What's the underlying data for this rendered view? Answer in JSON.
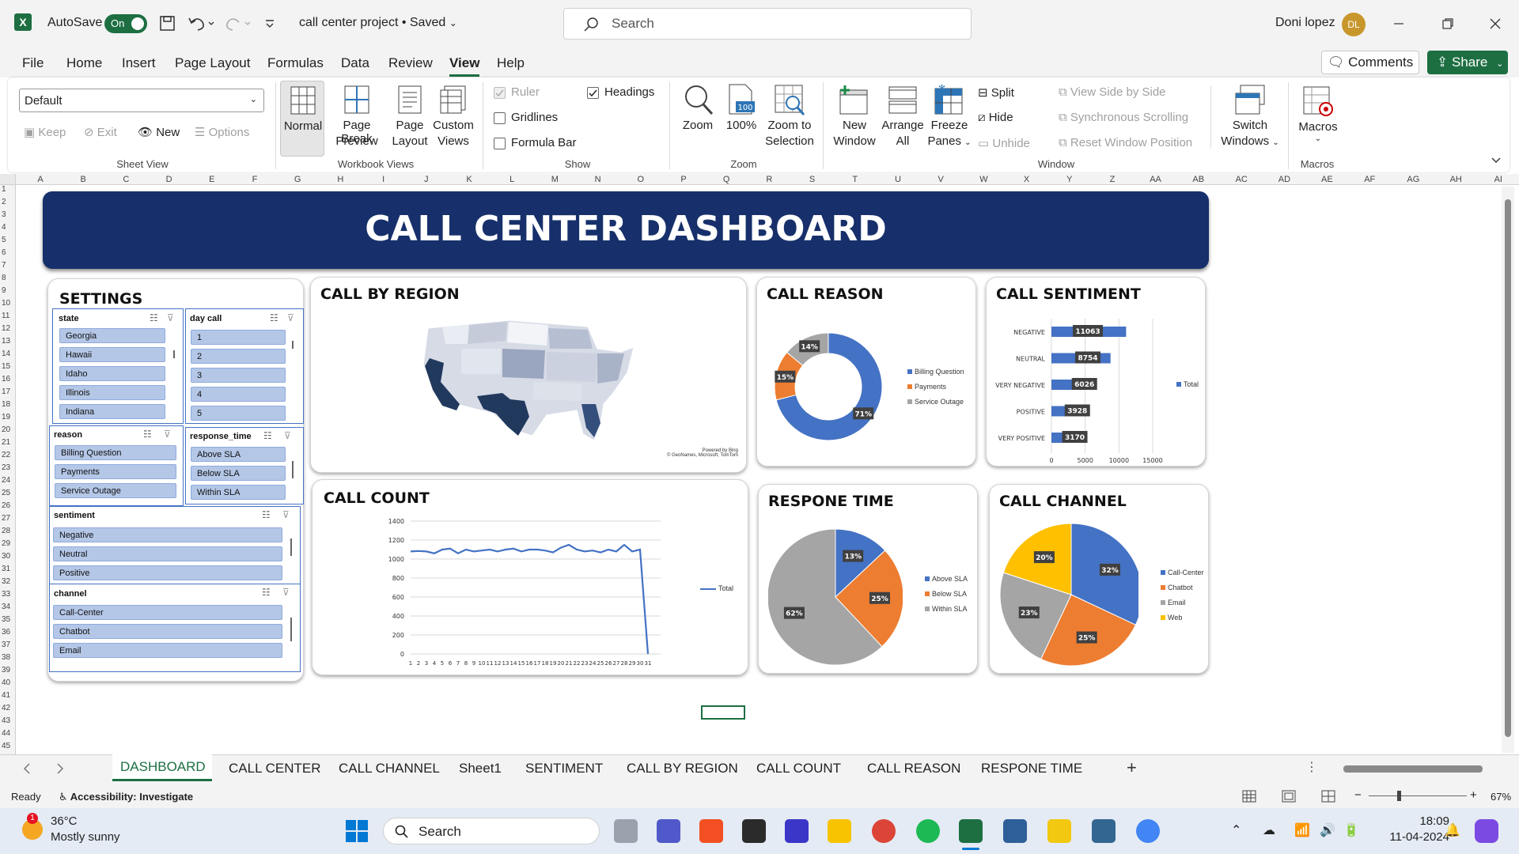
{
  "titlebar": {
    "app_icon": "excel-icon",
    "autosave_label": "AutoSave",
    "autosave_state": "On",
    "doc_title": "call center project • Saved",
    "search_placeholder": "Search",
    "user_name": "Doni lopez",
    "user_initials": "DL"
  },
  "menu": {
    "items": [
      "File",
      "Home",
      "Insert",
      "Page Layout",
      "Formulas",
      "Data",
      "Review",
      "View",
      "Help"
    ],
    "active": "View",
    "comments": "Comments",
    "share": "Share"
  },
  "ribbon": {
    "sheet_view": {
      "dropdown": "Default",
      "keep": "Keep",
      "exit": "Exit",
      "new": "New",
      "options": "Options",
      "group": "Sheet View"
    },
    "workbook_views": {
      "normal": "Normal",
      "page_break_1": "Page Break",
      "page_break_2": "Preview",
      "page_layout_1": "Page",
      "page_layout_2": "Layout",
      "custom_1": "Custom",
      "custom_2": "Views",
      "group": "Workbook Views"
    },
    "show": {
      "ruler": "Ruler",
      "headings": "Headings",
      "gridlines": "Gridlines",
      "formula_bar": "Formula Bar",
      "group": "Show"
    },
    "zoom": {
      "zoom": "Zoom",
      "hundred": "100%",
      "zoom_sel_1": "Zoom to",
      "zoom_sel_2": "Selection",
      "group": "Zoom"
    },
    "window": {
      "new_window_1": "New",
      "new_window_2": "Window",
      "arrange_1": "Arrange",
      "arrange_2": "All",
      "freeze_1": "Freeze",
      "freeze_2": "Panes",
      "split": "Split",
      "hide": "Hide",
      "unhide": "Unhide",
      "side_by_side": "View Side by Side",
      "sync_scroll": "Synchronous Scrolling",
      "reset_pos": "Reset Window Position",
      "switch_1": "Switch",
      "switch_2": "Windows",
      "group": "Window"
    },
    "macros": {
      "label": "Macros",
      "group": "Macros"
    }
  },
  "columns": [
    "A",
    "B",
    "C",
    "D",
    "E",
    "F",
    "G",
    "H",
    "I",
    "J",
    "K",
    "L",
    "M",
    "N",
    "O",
    "P",
    "Q",
    "R",
    "S",
    "T",
    "U",
    "V",
    "W",
    "X",
    "Y",
    "Z",
    "AA",
    "AB",
    "AC",
    "AD",
    "AE",
    "AF",
    "AG",
    "AH",
    "AI"
  ],
  "rows": [
    "1",
    "2",
    "3",
    "4",
    "5",
    "6",
    "7",
    "8",
    "9",
    "10",
    "11",
    "12",
    "13",
    "14",
    "15",
    "16",
    "17",
    "18",
    "19",
    "20",
    "21",
    "22",
    "23",
    "24",
    "25",
    "26",
    "27",
    "28",
    "29",
    "30",
    "31",
    "32",
    "33",
    "34",
    "35",
    "36",
    "37",
    "38",
    "39",
    "40",
    "41",
    "42",
    "43",
    "44",
    "45"
  ],
  "dashboard": {
    "title": "CALL CENTER DASHBOARD",
    "settings": {
      "title": "SETTINGS",
      "state": {
        "header": "state",
        "items": [
          "Georgia",
          "Hawaii",
          "Idaho",
          "Illinois",
          "Indiana"
        ]
      },
      "day_call": {
        "header": "day call",
        "items": [
          "1",
          "2",
          "3",
          "4",
          "5"
        ]
      },
      "reason": {
        "header": "reason",
        "items": [
          "Billing Question",
          "Payments",
          "Service Outage"
        ]
      },
      "response_time": {
        "header": "response_time",
        "items": [
          "Above SLA",
          "Below SLA",
          "Within SLA"
        ]
      },
      "sentiment": {
        "header": "sentiment",
        "items": [
          "Negative",
          "Neutral",
          "Positive"
        ]
      },
      "channel": {
        "header": "channel",
        "items": [
          "Call-Center",
          "Chatbot",
          "Email"
        ]
      }
    },
    "region": {
      "title": "CALL BY REGION",
      "credit_1": "Powered by Bing",
      "credit_2": "© GeoNames, Microsoft, TomTom"
    },
    "reason_title": "CALL REASON",
    "sentiment_title": "CALL SENTIMENT",
    "count_title": "CALL COUNT",
    "response_title": "RESPONE TIME",
    "channel_title": "CALL CHANNEL"
  },
  "chart_data": [
    {
      "type": "pie",
      "title": "CALL REASON",
      "categories": [
        "Billing Question",
        "Payments",
        "Service Outage"
      ],
      "values": [
        71,
        15,
        14
      ],
      "labels": [
        "71%",
        "15%",
        "14%"
      ],
      "colors": [
        "#4472c4",
        "#ed7d31",
        "#a5a5a5"
      ],
      "donut": true
    },
    {
      "type": "bar",
      "title": "CALL SENTIMENT",
      "orientation": "horizontal",
      "categories": [
        "NEGATIVE",
        "NEUTRAL",
        "VERY NEGATIVE",
        "POSITIVE",
        "VERY POSITIVE"
      ],
      "values": [
        11063,
        8754,
        6026,
        3928,
        3170
      ],
      "series": [
        {
          "name": "Total"
        }
      ],
      "xticks": [
        "0",
        "5000",
        "10000",
        "15000"
      ],
      "xlim": [
        0,
        15000
      ],
      "color": "#4472c4"
    },
    {
      "type": "line",
      "title": "CALL COUNT",
      "x": [
        "1",
        "2",
        "3",
        "4",
        "5",
        "6",
        "7",
        "8",
        "9",
        "10",
        "11",
        "12",
        "13",
        "14",
        "15",
        "16",
        "17",
        "18",
        "19",
        "20",
        "21",
        "22",
        "23",
        "24",
        "25",
        "26",
        "27",
        "28",
        "29",
        "30",
        "31"
      ],
      "values": [
        1080,
        1085,
        1080,
        1060,
        1100,
        1110,
        1060,
        1100,
        1080,
        1090,
        1100,
        1080,
        1100,
        1110,
        1080,
        1100,
        1100,
        1090,
        1070,
        1120,
        1150,
        1100,
        1080,
        1090,
        1070,
        1100,
        1080,
        1150,
        1080,
        1100,
        0
      ],
      "series": [
        {
          "name": "Total"
        }
      ],
      "yticks": [
        "0",
        "200",
        "400",
        "600",
        "800",
        "1000",
        "1200",
        "1400"
      ],
      "ylim": [
        0,
        1400
      ],
      "color": "#4472c4"
    },
    {
      "type": "pie",
      "title": "RESPONE TIME",
      "categories": [
        "Above SLA",
        "Below SLA",
        "Within SLA"
      ],
      "values": [
        13,
        25,
        62
      ],
      "labels": [
        "13%",
        "25%",
        "62%"
      ],
      "colors": [
        "#4472c4",
        "#ed7d31",
        "#a5a5a5"
      ]
    },
    {
      "type": "pie",
      "title": "CALL CHANNEL",
      "categories": [
        "Call-Center",
        "Chatbot",
        "Email",
        "Web"
      ],
      "values": [
        32,
        25,
        23,
        20
      ],
      "labels": [
        "32%",
        "25%",
        "23%",
        "20%"
      ],
      "colors": [
        "#4472c4",
        "#ed7d31",
        "#a5a5a5",
        "#ffc000"
      ]
    }
  ],
  "sheets": {
    "tabs": [
      "DASHBOARD",
      "CALL CENTER",
      "CALL CHANNEL",
      "Sheet1",
      "SENTIMENT",
      "CALL BY REGION",
      "CALL COUNT",
      "CALL REASON",
      "RESPONE TIME"
    ],
    "active": "DASHBOARD",
    "add": "+"
  },
  "status": {
    "ready": "Ready",
    "accessibility": "Accessibility: Investigate",
    "zoom": "67%"
  },
  "taskbar": {
    "temp": "36°C",
    "weather": "Mostly sunny",
    "badge": "1",
    "search": "Search",
    "time": "18:09",
    "date": "11-04-2024"
  }
}
